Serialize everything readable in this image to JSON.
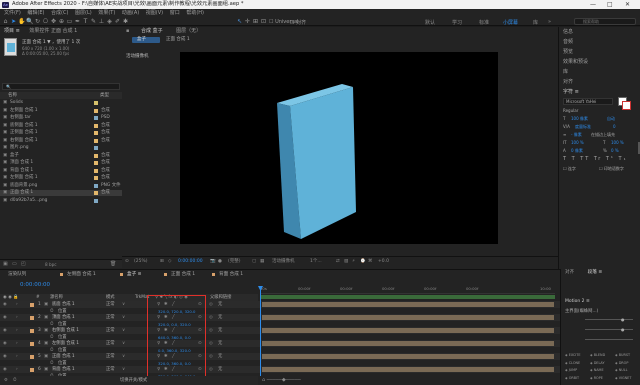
{
  "window": {
    "app_icon": "Ae",
    "title": "Adobe After Effects 2020 - F:\\自媒体\\AE实战项目\\光效\\画面元素\\制作教程\\光效元素画面组.aep *",
    "minimize": "—",
    "maximize": "□",
    "close": "✕"
  },
  "menu": [
    "文件(F)",
    "编辑(E)",
    "合成(C)",
    "图层(L)",
    "效果(T)",
    "动画(A)",
    "视图(V)",
    "窗口",
    "帮助(H)"
  ],
  "toolbar": {
    "checkbox1": "Universal",
    "checkbox2": "对齐",
    "workspaces": [
      "默认",
      "学习",
      "标准",
      "小屏幕",
      "库"
    ],
    "active_ws": "小屏幕",
    "search_placeholder": "搜索帮助"
  },
  "project": {
    "tabs": [
      "项目 ≡",
      "效果控件 正面 合成 1"
    ],
    "comp_name": "正面 合成 1 ▼ ，使用了 1 次",
    "comp_info1": "640 x 720 (1.00 x 1.00)",
    "comp_info2": "Δ 0:00:05:00, 25.00 fps",
    "search_placeholder": "🔍",
    "col_name": "名称",
    "col_type": "类型",
    "items": [
      {
        "name": "Solids",
        "type": "",
        "color": "#d6c16b"
      },
      {
        "name": "左侧面 合成 1",
        "type": "合成",
        "color": "#e2b76b"
      },
      {
        "name": "右侧面.tar",
        "type": "PSD",
        "color": "#7fa8c4"
      },
      {
        "name": "底侧面 合成 1",
        "type": "合成",
        "color": "#e2b76b"
      },
      {
        "name": "正侧面 合成 1",
        "type": "合成",
        "color": "#e2b76b"
      },
      {
        "name": "右侧面 合成 1",
        "type": "合成",
        "color": "#e2b76b"
      },
      {
        "name": "图片.png",
        "type": "",
        "color": "#7fa8c4"
      },
      {
        "name": "盒子",
        "type": "合成",
        "color": "#e2b76b"
      },
      {
        "name": "顶面 合成 1",
        "type": "合成",
        "color": "#e2b76b"
      },
      {
        "name": "背面 合成 1",
        "type": "合成",
        "color": "#e2b76b"
      },
      {
        "name": "左侧面 合成 1",
        "type": "合成",
        "color": "#e2b76b"
      },
      {
        "name": "底面背景.png",
        "type": "PNG 文件",
        "color": "#7fa8c4"
      },
      {
        "name": "正面 合成 1",
        "type": "合成",
        "color": "#e2b76b"
      },
      {
        "name": "d0a92b7a5...png",
        "type": "",
        "color": "#7fa8c4"
      }
    ],
    "footer": "8 bpc"
  },
  "composition": {
    "tabs": [
      "合成 盒子",
      "图层（无）"
    ],
    "breadcrumb": [
      "盒子",
      "正面 合成 1"
    ],
    "label": "活动摄像机",
    "footer": {
      "zoom": "(25%)",
      "time": "0:00:00:00",
      "res": "(完整)",
      "camera": "活动摄像机",
      "view": "1个...",
      "offset": "+0.0"
    }
  },
  "right_panel": {
    "items": [
      "信息",
      "音频",
      "预览",
      "效果和预设",
      "库",
      "对齐",
      "字符 ≡"
    ],
    "font": "Microsoft YaHei",
    "style": "Regular",
    "size": "100 像素",
    "leading": "自动",
    "kerning": "度量标准",
    "tracking": "0",
    "stroke": "- 像素",
    "stroke_mode": "在描边上填充",
    "scale_v": "100 %",
    "scale_h": "100 %",
    "baseline": "0 像素",
    "tsume": "0 %",
    "ligature": "连字",
    "hindi": "印地语数字"
  },
  "timeline": {
    "tabs": [
      "渲染队列",
      "左侧面 合成 1",
      "盒子 ≡",
      "正面 合成 1",
      "背面 合成 1"
    ],
    "active_tab": "盒子 ≡",
    "timecode": "0:00:00:00",
    "col_num": "#",
    "col_name": "源名称",
    "col_mode": "模式",
    "col_trk": "TrkMat",
    "col_parent": "父级和链接",
    "ruler": [
      "00s",
      "00:00f",
      "00:00f",
      "00:00f",
      "00:00f",
      "00:00f",
      "10:00"
    ],
    "layers": [
      {
        "num": "1",
        "name": "底面 合成 1",
        "mode": "正常",
        "parent": "无",
        "sub": "位置",
        "val": "320.0, 720.0, 320.0"
      },
      {
        "num": "2",
        "name": "顶面 合成 1",
        "mode": "正常",
        "parent": "无",
        "sub": "位置",
        "val": "320.0, 0.0, 320.0"
      },
      {
        "num": "3",
        "name": "右侧面 合成 1",
        "mode": "正常",
        "parent": "无",
        "sub": "位置",
        "val": "640.0, 360.0, 0.0"
      },
      {
        "num": "4",
        "name": "左侧面 合成 1",
        "mode": "正常",
        "parent": "无",
        "sub": "位置",
        "val": "0.0, 360.0, 320.0"
      },
      {
        "num": "5",
        "name": "正面 合成 1",
        "mode": "正常",
        "parent": "无",
        "sub": "位置",
        "val": "320.0, 360.0, 0.0"
      },
      {
        "num": "6",
        "name": "背面 合成 1",
        "mode": "正常",
        "parent": "无",
        "sub": "位置",
        "val": "320.0, 360.0, 640.0"
      }
    ],
    "footer": "切换开关/模式"
  },
  "right_bottom": {
    "tabs": [
      "对齐",
      "段落 ≡"
    ],
    "motion": "Motion 2 ≡",
    "mode": "主界面(蜘蛛网...)",
    "labels": [
      "EXCITE",
      "BLEND",
      "BURST",
      "CLONE",
      "DELAY",
      "DROP",
      "JUMP",
      "NAME",
      "NULL",
      "ORBIT",
      "ROPE",
      "VIGNET"
    ]
  },
  "colors": {
    "accent": "#2d8ceb",
    "box_front": "#5fb2d8",
    "box_side": "#4a98c0",
    "box_top": "#7cc6e6",
    "highlight": "#e0302a",
    "label_orange": "#d8a16b"
  }
}
